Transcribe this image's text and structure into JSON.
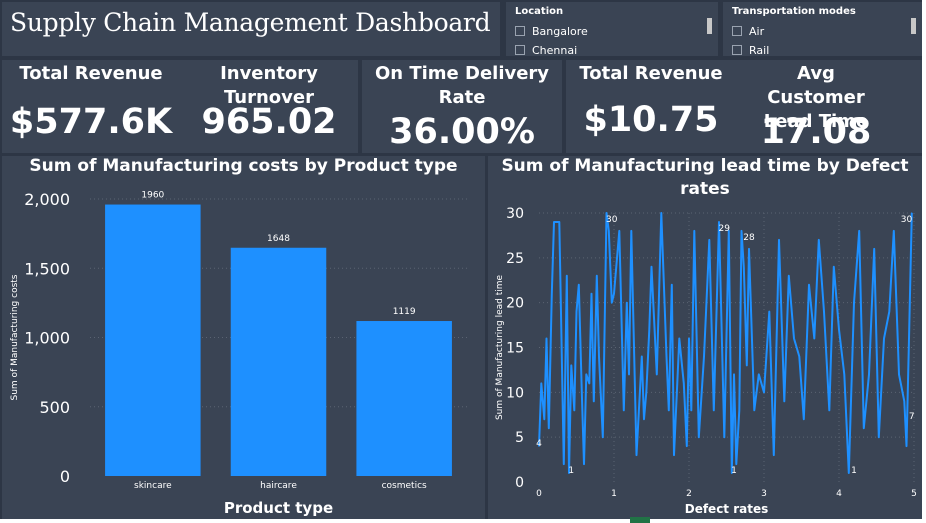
{
  "dashboard": {
    "title": "Supply Chain Management Dashboard"
  },
  "slicers": [
    {
      "header": "Location",
      "items": [
        "Bangalore",
        "Chennai"
      ]
    },
    {
      "header": "Transportation modes",
      "items": [
        "Air",
        "Rail"
      ]
    }
  ],
  "kpis": [
    {
      "label": "Total Revenue",
      "value": "$577.6K"
    },
    {
      "label": "Inventory Turnover",
      "value": "965.02"
    },
    {
      "label": "On Time Delivery Rate",
      "value": "36.00%"
    },
    {
      "label": "Total Revenue",
      "value": "$10.75"
    },
    {
      "label": "Avg Customer Lead Time",
      "value": "17.08"
    }
  ],
  "colors": {
    "background": "#2d3645",
    "panel": "#3a4454",
    "series": "#1e90ff",
    "grid": "#5a6372"
  },
  "chart_data": [
    {
      "type": "bar",
      "title": "Sum of Manufacturing costs by Product type",
      "xlabel": "Product type",
      "ylabel": "Sum of Manufacturing costs",
      "categories": [
        "skincare",
        "haircare",
        "cosmetics"
      ],
      "values": [
        1960,
        1648,
        1119
      ],
      "data_labels": [
        "1960",
        "1648",
        "1119"
      ],
      "ylim": [
        0,
        2000
      ],
      "yticks": [
        0,
        500,
        1000,
        1500,
        2000
      ],
      "ytick_labels": [
        "0",
        "500",
        "1,000",
        "1,500",
        "2,000"
      ],
      "grid": true
    },
    {
      "type": "line",
      "title": "Sum of Manufacturing lead time by Defect rates",
      "xlabel": "Defect rates",
      "ylabel": "Sum of Manufacturing lead time",
      "xlim": [
        0,
        5
      ],
      "ylim": [
        0,
        30
      ],
      "xticks": [
        0,
        1,
        2,
        3,
        4,
        5
      ],
      "xtick_labels": [
        "0",
        "1",
        "2",
        "3",
        "4",
        "5"
      ],
      "yticks": [
        0,
        5,
        10,
        15,
        20,
        25,
        30
      ],
      "ytick_labels": [
        "0",
        "5",
        "10",
        "15",
        "20",
        "25",
        "30"
      ],
      "x": [
        0.0,
        0.03,
        0.07,
        0.1,
        0.13,
        0.17,
        0.2,
        0.27,
        0.33,
        0.37,
        0.4,
        0.43,
        0.47,
        0.5,
        0.53,
        0.57,
        0.6,
        0.63,
        0.67,
        0.7,
        0.73,
        0.77,
        0.8,
        0.85,
        0.9,
        0.93,
        0.97,
        1.0,
        1.07,
        1.13,
        1.17,
        1.2,
        1.23,
        1.3,
        1.37,
        1.4,
        1.43,
        1.47,
        1.5,
        1.57,
        1.63,
        1.7,
        1.73,
        1.77,
        1.8,
        1.87,
        1.93,
        1.97,
        2.0,
        2.03,
        2.07,
        2.13,
        2.2,
        2.27,
        2.33,
        2.4,
        2.47,
        2.53,
        2.57,
        2.6,
        2.63,
        2.67,
        2.7,
        2.73,
        2.77,
        2.8,
        2.87,
        2.93,
        3.0,
        3.07,
        3.13,
        3.2,
        3.27,
        3.33,
        3.4,
        3.47,
        3.53,
        3.6,
        3.67,
        3.73,
        3.8,
        3.87,
        3.93,
        4.0,
        4.07,
        4.13,
        4.2,
        4.27,
        4.33,
        4.4,
        4.47,
        4.53,
        4.6,
        4.67,
        4.73,
        4.8,
        4.87,
        4.9,
        4.93,
        4.97
      ],
      "y": [
        4,
        11,
        7,
        16,
        6,
        21,
        29,
        29,
        2,
        23,
        1,
        13,
        8,
        19,
        22,
        10,
        2,
        12,
        11,
        21,
        9,
        23,
        14,
        5,
        30,
        28,
        20,
        21,
        28,
        8,
        20,
        12,
        28,
        3,
        14,
        7,
        10,
        17,
        24,
        12,
        30,
        14,
        8,
        22,
        3,
        16,
        11,
        4,
        16,
        8,
        28,
        5,
        14,
        27,
        8,
        29,
        5,
        28,
        1,
        12,
        2,
        8,
        28,
        24,
        13,
        26,
        8,
        12,
        10,
        19,
        3,
        27,
        9,
        23,
        16,
        14,
        7,
        22,
        16,
        27,
        19,
        8,
        24,
        17,
        12,
        1,
        20,
        28,
        6,
        12,
        26,
        5,
        16,
        19,
        28,
        12,
        9,
        4,
        15,
        30
      ],
      "data_labels": [
        {
          "x": 0.0,
          "y": 4,
          "text": "4"
        },
        {
          "x": 0.43,
          "y": 1,
          "text": "1"
        },
        {
          "x": 0.97,
          "y": 30,
          "text": "30"
        },
        {
          "x": 2.47,
          "y": 29,
          "text": "29"
        },
        {
          "x": 2.6,
          "y": 1,
          "text": "1"
        },
        {
          "x": 2.8,
          "y": 28,
          "text": "28"
        },
        {
          "x": 4.2,
          "y": 1,
          "text": "1"
        },
        {
          "x": 4.9,
          "y": 30,
          "text": "30"
        },
        {
          "x": 4.97,
          "y": 7,
          "text": "7"
        }
      ],
      "grid": true
    }
  ]
}
